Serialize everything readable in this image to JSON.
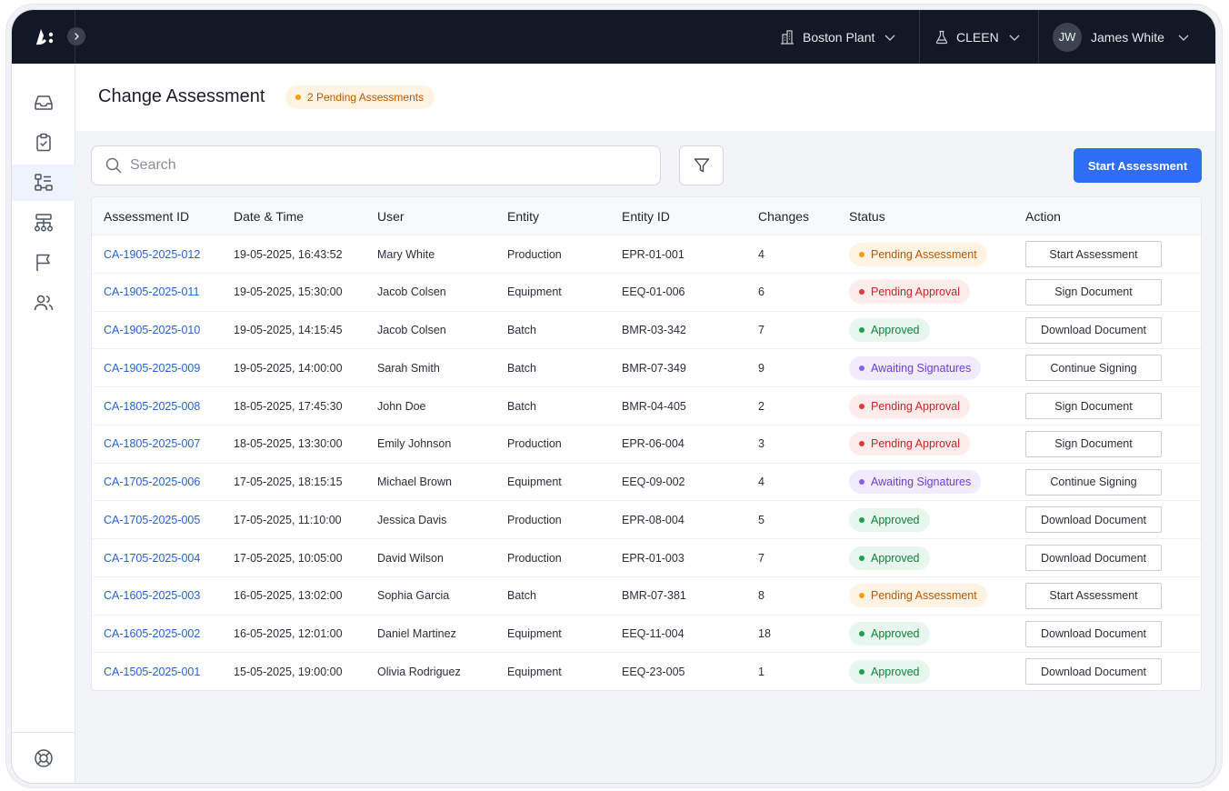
{
  "colors": {
    "topbar": "#121826",
    "accent": "#2f6df6",
    "link": "#2563d9",
    "pending_assessment": {
      "bg": "#fff4e3",
      "fg": "#b8590a",
      "dot": "#f59e0b"
    },
    "pending_approval": {
      "bg": "#fdecec",
      "fg": "#c62828",
      "dot": "#e53935"
    },
    "approved": {
      "bg": "#e8f7ee",
      "fg": "#15803d",
      "dot": "#16a34a"
    },
    "awaiting_signatures": {
      "bg": "#f1ecfd",
      "fg": "#6d3fd1",
      "dot": "#8b5cf6"
    }
  },
  "topbar": {
    "logo_icon": "brand-logo-icon",
    "expand_icon": "chevron-right-icon",
    "site": {
      "label": "Boston Plant",
      "icon": "building-icon"
    },
    "workspace": {
      "label": "CLEEN",
      "icon": "flask-icon"
    },
    "user": {
      "initials": "JW",
      "name": "James White"
    }
  },
  "sidebar": {
    "items": [
      {
        "icon": "inbox-icon",
        "active": false
      },
      {
        "icon": "clipboard-check-icon",
        "active": false
      },
      {
        "icon": "change-assessment-icon",
        "active": true
      },
      {
        "icon": "hierarchy-icon",
        "active": false
      },
      {
        "icon": "flag-icon",
        "active": false
      },
      {
        "icon": "users-icon",
        "active": false
      }
    ],
    "bottom_icon": "lifebuoy-icon"
  },
  "header": {
    "title": "Change Assessment",
    "badge": "2 Pending Assessments"
  },
  "toolbar": {
    "search_placeholder": "Search",
    "filter_icon": "filter-icon",
    "start_button": "Start Assessment"
  },
  "table": {
    "columns": [
      "Assessment ID",
      "Date & Time",
      "User",
      "Entity",
      "Entity ID",
      "Changes",
      "Status",
      "Action"
    ],
    "rows": [
      {
        "id": "CA-1905-2025-012",
        "datetime": "19-05-2025, 16:43:52",
        "user": "Mary White",
        "entity": "Production",
        "entity_id": "EPR-01-001",
        "changes": "4",
        "status": "Pending Assessment",
        "status_key": "pending_assessment",
        "action": "Start Assessment"
      },
      {
        "id": "CA-1905-2025-011",
        "datetime": "19-05-2025, 15:30:00",
        "user": "Jacob Colsen",
        "entity": "Equipment",
        "entity_id": "EEQ-01-006",
        "changes": "6",
        "status": "Pending Approval",
        "status_key": "pending_approval",
        "action": "Sign Document"
      },
      {
        "id": "CA-1905-2025-010",
        "datetime": "19-05-2025, 14:15:45",
        "user": "Jacob Colsen",
        "entity": "Batch",
        "entity_id": "BMR-03-342",
        "changes": "7",
        "status": "Approved",
        "status_key": "approved",
        "action": "Download Document"
      },
      {
        "id": "CA-1905-2025-009",
        "datetime": "19-05-2025, 14:00:00",
        "user": "Sarah Smith",
        "entity": "Batch",
        "entity_id": "BMR-07-349",
        "changes": "9",
        "status": "Awaiting Signatures",
        "status_key": "awaiting_signatures",
        "action": "Continue Signing"
      },
      {
        "id": "CA-1805-2025-008",
        "datetime": "18-05-2025, 17:45:30",
        "user": "John Doe",
        "entity": "Batch",
        "entity_id": "BMR-04-405",
        "changes": "2",
        "status": "Pending Approval",
        "status_key": "pending_approval",
        "action": "Sign Document"
      },
      {
        "id": "CA-1805-2025-007",
        "datetime": "18-05-2025, 13:30:00",
        "user": "Emily Johnson",
        "entity": "Production",
        "entity_id": "EPR-06-004",
        "changes": "3",
        "status": "Pending Approval",
        "status_key": "pending_approval",
        "action": "Sign Document"
      },
      {
        "id": "CA-1705-2025-006",
        "datetime": "17-05-2025, 18:15:15",
        "user": "Michael Brown",
        "entity": "Equipment",
        "entity_id": "EEQ-09-002",
        "changes": "4",
        "status": "Awaiting Signatures",
        "status_key": "awaiting_signatures",
        "action": "Continue Signing"
      },
      {
        "id": "CA-1705-2025-005",
        "datetime": "17-05-2025, 11:10:00",
        "user": "Jessica Davis",
        "entity": "Production",
        "entity_id": "EPR-08-004",
        "changes": "5",
        "status": "Approved",
        "status_key": "approved",
        "action": "Download Document"
      },
      {
        "id": "CA-1705-2025-004",
        "datetime": "17-05-2025, 10:05:00",
        "user": "David Wilson",
        "entity": "Production",
        "entity_id": "EPR-01-003",
        "changes": "7",
        "status": "Approved",
        "status_key": "approved",
        "action": "Download Document"
      },
      {
        "id": "CA-1605-2025-003",
        "datetime": "16-05-2025, 13:02:00",
        "user": "Sophia Garcia",
        "entity": "Batch",
        "entity_id": "BMR-07-381",
        "changes": "8",
        "status": "Pending Assessment",
        "status_key": "pending_assessment",
        "action": "Start Assessment"
      },
      {
        "id": "CA-1605-2025-002",
        "datetime": "16-05-2025, 12:01:00",
        "user": "Daniel Martinez",
        "entity": "Equipment",
        "entity_id": "EEQ-11-004",
        "changes": "18",
        "status": "Approved",
        "status_key": "approved",
        "action": "Download Document"
      },
      {
        "id": "CA-1505-2025-001",
        "datetime": "15-05-2025, 19:00:00",
        "user": "Olivia Rodriguez",
        "entity": "Equipment",
        "entity_id": "EEQ-23-005",
        "changes": "1",
        "status": "Approved",
        "status_key": "approved",
        "action": "Download Document"
      }
    ]
  }
}
